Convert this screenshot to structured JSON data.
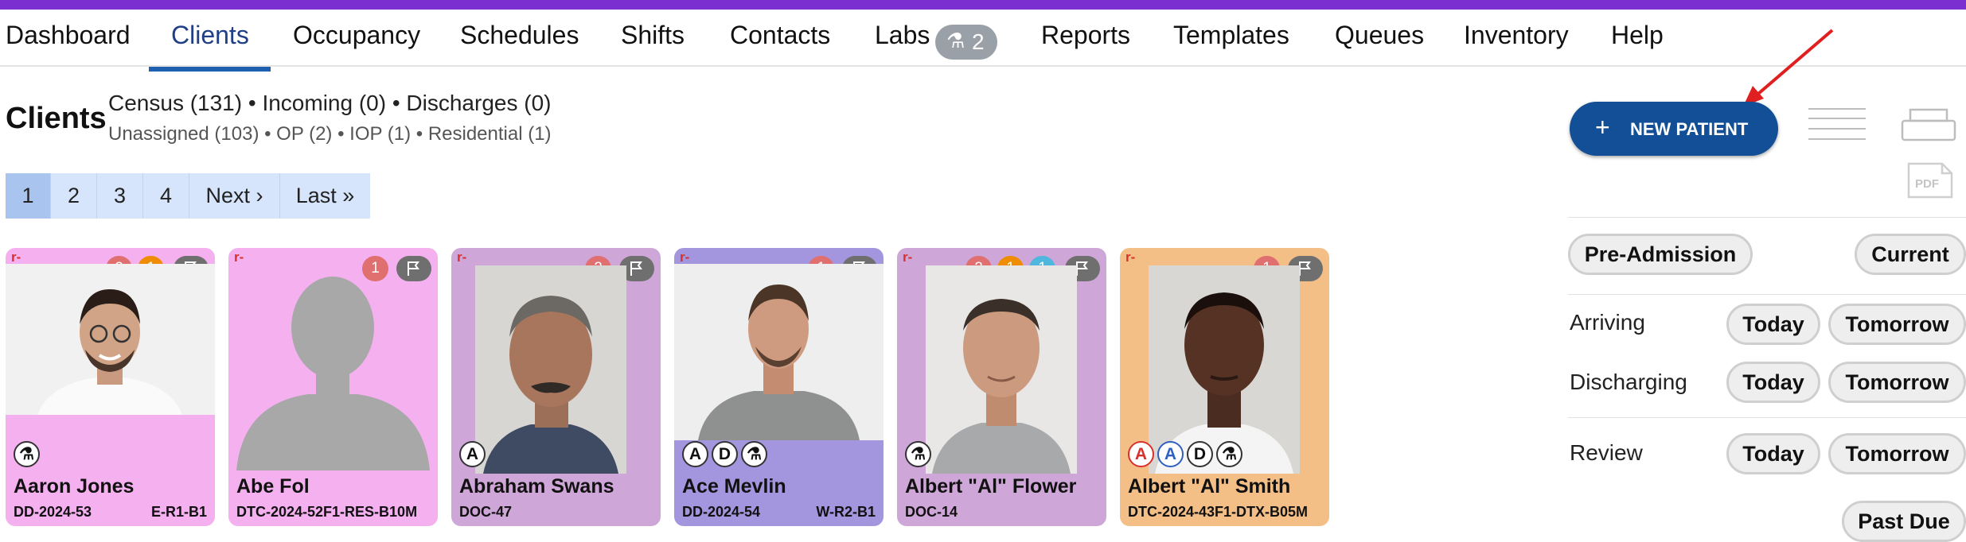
{
  "nav": {
    "items": [
      {
        "label": "Dashboard"
      },
      {
        "label": "Clients"
      },
      {
        "label": "Occupancy"
      },
      {
        "label": "Schedules"
      },
      {
        "label": "Shifts"
      },
      {
        "label": "Contacts"
      },
      {
        "label": "Labs",
        "badge": "2"
      },
      {
        "label": "Reports"
      },
      {
        "label": "Templates"
      },
      {
        "label": "Queues"
      },
      {
        "label": "Inventory"
      },
      {
        "label": "Help"
      }
    ],
    "active": "Clients"
  },
  "page": {
    "title": "Clients",
    "summary_line1": "Census (131) • Incoming (0) • Discharges (0)",
    "summary_line2": "Unassigned (103) • OP (2) • IOP (1) • Residential (1)"
  },
  "pagination": {
    "pages": [
      "1",
      "2",
      "3",
      "4"
    ],
    "current": "1",
    "next": "Next ›",
    "last": "Last »"
  },
  "cards": [
    {
      "tag": "r-",
      "name": "Aaron Jones",
      "id": "DD-2024-53",
      "room": "E-R1-B1",
      "background": "#f5b0f0",
      "badges": [
        "2",
        "1"
      ],
      "indicators": [
        "lab"
      ]
    },
    {
      "tag": "r-",
      "name": "Abe Fol",
      "id": "DTC-2024-52F1-RES-B10M",
      "room": "",
      "background": "#f5b0f0",
      "badges": [
        "1"
      ],
      "indicators": []
    },
    {
      "tag": "r-",
      "name": "Abraham Swans",
      "id": "DOC-47",
      "room": "",
      "background": "#cfa6d8",
      "badges": [
        "2"
      ],
      "indicators": [
        "A"
      ]
    },
    {
      "tag": "r-",
      "name": "Ace Mevlin",
      "id": "DD-2024-54",
      "room": "W-R2-B1",
      "background": "#a396de",
      "badges": [
        "1"
      ],
      "indicators": [
        "A",
        "D",
        "lab"
      ]
    },
    {
      "tag": "r-",
      "name": "Albert \"Al\" Flower",
      "id": "DOC-14",
      "room": "",
      "background": "#cfa6d8",
      "badges": [
        "2",
        "1",
        "1"
      ],
      "indicators": [
        "lab"
      ]
    },
    {
      "tag": "r-",
      "name": "Albert \"Al\" Smith",
      "id": "DTC-2024-43F1-DTX-B05M",
      "room": "",
      "background": "#f3bf86",
      "badges": [
        "1"
      ],
      "indicators": [
        "A",
        "A",
        "D",
        "lab"
      ]
    }
  ],
  "sidebar": {
    "new_patient": "NEW PATIENT",
    "pre_admission": "Pre-Admission",
    "current": "Current",
    "arriving": "Arriving",
    "discharging": "Discharging",
    "review": "Review",
    "today": "Today",
    "tomorrow": "Tomorrow",
    "past_due": "Past Due",
    "pdf": "PDF"
  },
  "colors": {
    "top_bar": "#7b2fd0",
    "primary": "#124f96",
    "badge_red": "#e07070",
    "badge_orange": "#f08c00",
    "badge_cyan": "#4fb6de"
  }
}
